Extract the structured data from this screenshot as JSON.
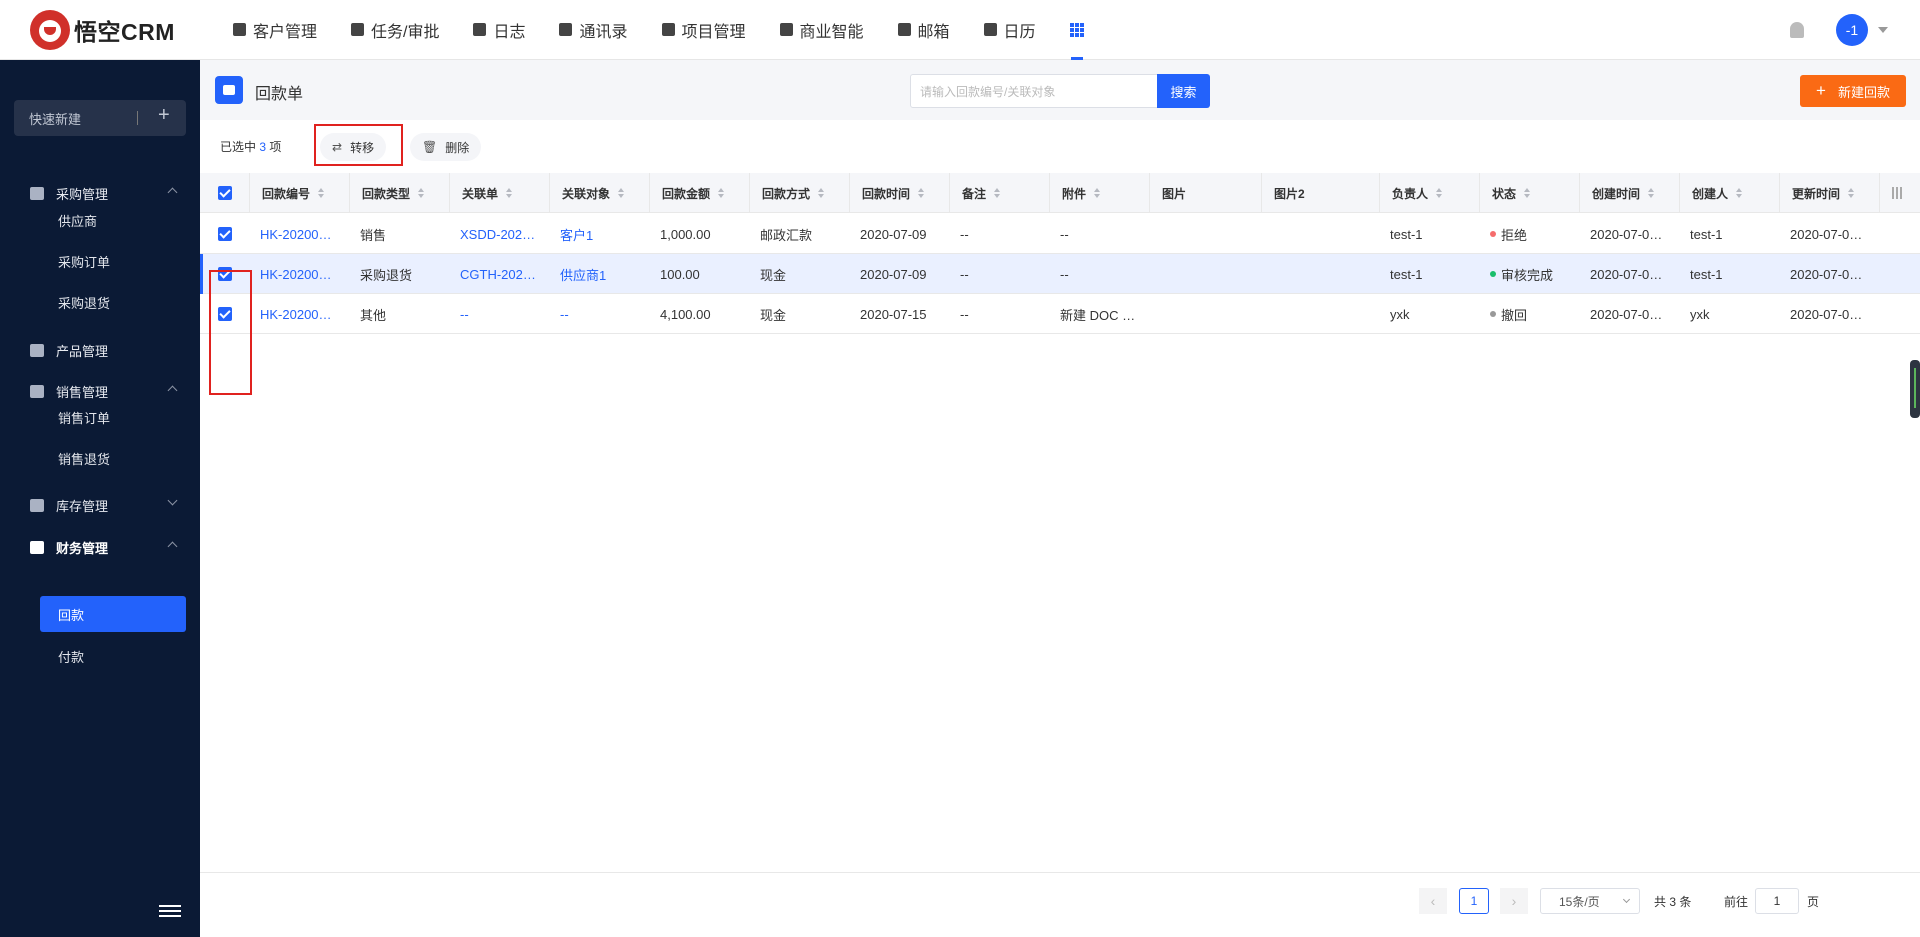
{
  "brand": {
    "name": "悟空CRM"
  },
  "nav": {
    "items": [
      {
        "label": "客户管理",
        "icon": "customer-icon"
      },
      {
        "label": "任务/审批",
        "icon": "briefcase-icon"
      },
      {
        "label": "日志",
        "icon": "log-icon"
      },
      {
        "label": "通讯录",
        "icon": "phone-book-icon"
      },
      {
        "label": "项目管理",
        "icon": "project-icon"
      },
      {
        "label": "商业智能",
        "icon": "bi-icon"
      },
      {
        "label": "邮箱",
        "icon": "mail-icon"
      },
      {
        "label": "日历",
        "icon": "calendar-icon"
      }
    ],
    "apps_icon": "apps-grid-icon",
    "avatar_text": "-1"
  },
  "sidebar": {
    "quick_new": "快速新建",
    "groups": [
      {
        "label": "采购管理",
        "icon": "cart-icon",
        "expanded": true,
        "children": [
          "供应商",
          "采购订单",
          "采购退货"
        ]
      },
      {
        "label": "产品管理",
        "icon": "box-icon"
      },
      {
        "label": "销售管理",
        "icon": "tag-icon",
        "expanded": true,
        "children": [
          "销售订单",
          "销售退货"
        ]
      },
      {
        "label": "库存管理",
        "icon": "warehouse-icon",
        "expanded": false
      },
      {
        "label": "财务管理",
        "icon": "wallet-icon",
        "expanded": true,
        "children": [
          "回款",
          "付款"
        ]
      }
    ],
    "active_item": "回款"
  },
  "page": {
    "title": "回款单",
    "search_placeholder": "请输入回款编号/关联对象",
    "search_button": "搜索",
    "new_button": "新建回款",
    "selection_prefix": "已选中",
    "selection_count": "3",
    "selection_suffix": "项",
    "transfer_button": "转移",
    "delete_button": "删除"
  },
  "table": {
    "columns": [
      "回款编号",
      "回款类型",
      "关联单",
      "关联对象",
      "回款金额",
      "回款方式",
      "回款时间",
      "备注",
      "附件",
      "图片",
      "图片2",
      "负责人",
      "状态",
      "创建时间",
      "创建人",
      "更新时间"
    ],
    "rows": [
      {
        "cells": [
          "HK-20200…",
          "销售",
          "XSDD-202…",
          "客户1",
          "1,000.00",
          "邮政汇款",
          "2020-07-09",
          "--",
          "--",
          "",
          "",
          "test-1",
          "拒绝",
          "2020-07-0…",
          "test-1",
          "2020-07-0…"
        ],
        "status_color": "#f56c6c"
      },
      {
        "cells": [
          "HK-20200…",
          "采购退货",
          "CGTH-202…",
          "供应商1",
          "100.00",
          "现金",
          "2020-07-09",
          "--",
          "--",
          "",
          "",
          "test-1",
          "审核完成",
          "2020-07-0…",
          "test-1",
          "2020-07-0…"
        ],
        "status_color": "#19be6b"
      },
      {
        "cells": [
          "HK-20200…",
          "其他",
          "--",
          "--",
          "4,100.00",
          "现金",
          "2020-07-15",
          "--",
          "新建 DOC …",
          "",
          "",
          "yxk",
          "撤回",
          "2020-07-0…",
          "yxk",
          "2020-07-0…"
        ],
        "status_color": "#999999"
      }
    ]
  },
  "pagination": {
    "current": "1",
    "page_size": "15条/页",
    "total": "共 3 条",
    "goto_prefix": "前往",
    "goto_value": "1",
    "goto_suffix": "页"
  },
  "colors": {
    "primary": "#2362fb",
    "accent": "#fa6a14",
    "sidebar_bg": "#0b1a35"
  }
}
